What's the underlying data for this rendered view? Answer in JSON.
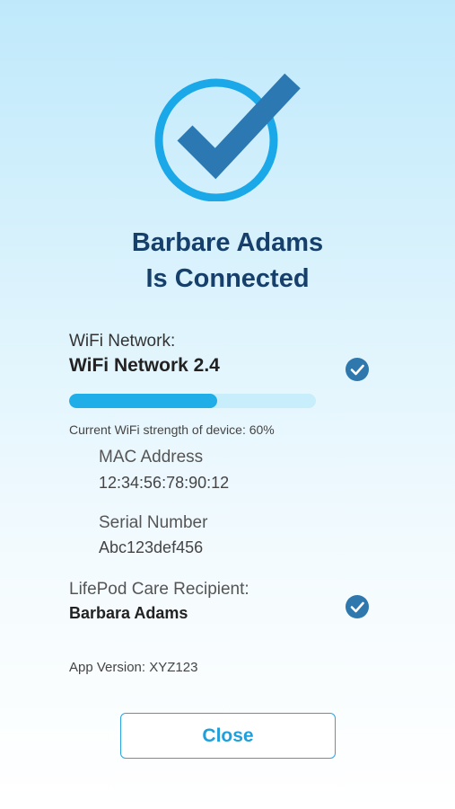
{
  "header": {
    "line1": "Barbare Adams",
    "line2": "Is Connected",
    "icon": "check-circle-icon"
  },
  "wifi": {
    "label": "WiFi Network:",
    "name": "WiFi Network 2.4",
    "strength_percent": 60,
    "strength_text": "Current WiFi strength of device: 60%"
  },
  "device": {
    "mac_label": "MAC Address",
    "mac_value": "12:34:56:78:90:12",
    "serial_label": "Serial Number",
    "serial_value": "Abc123def456"
  },
  "recipient": {
    "label": "LifePod Care Recipient:",
    "name": "Barbara Adams"
  },
  "app_version": "App Version: XYZ123",
  "actions": {
    "close_label": "Close"
  },
  "colors": {
    "accent": "#20aee8",
    "heading": "#16406b",
    "badge": "#2e78ad"
  }
}
